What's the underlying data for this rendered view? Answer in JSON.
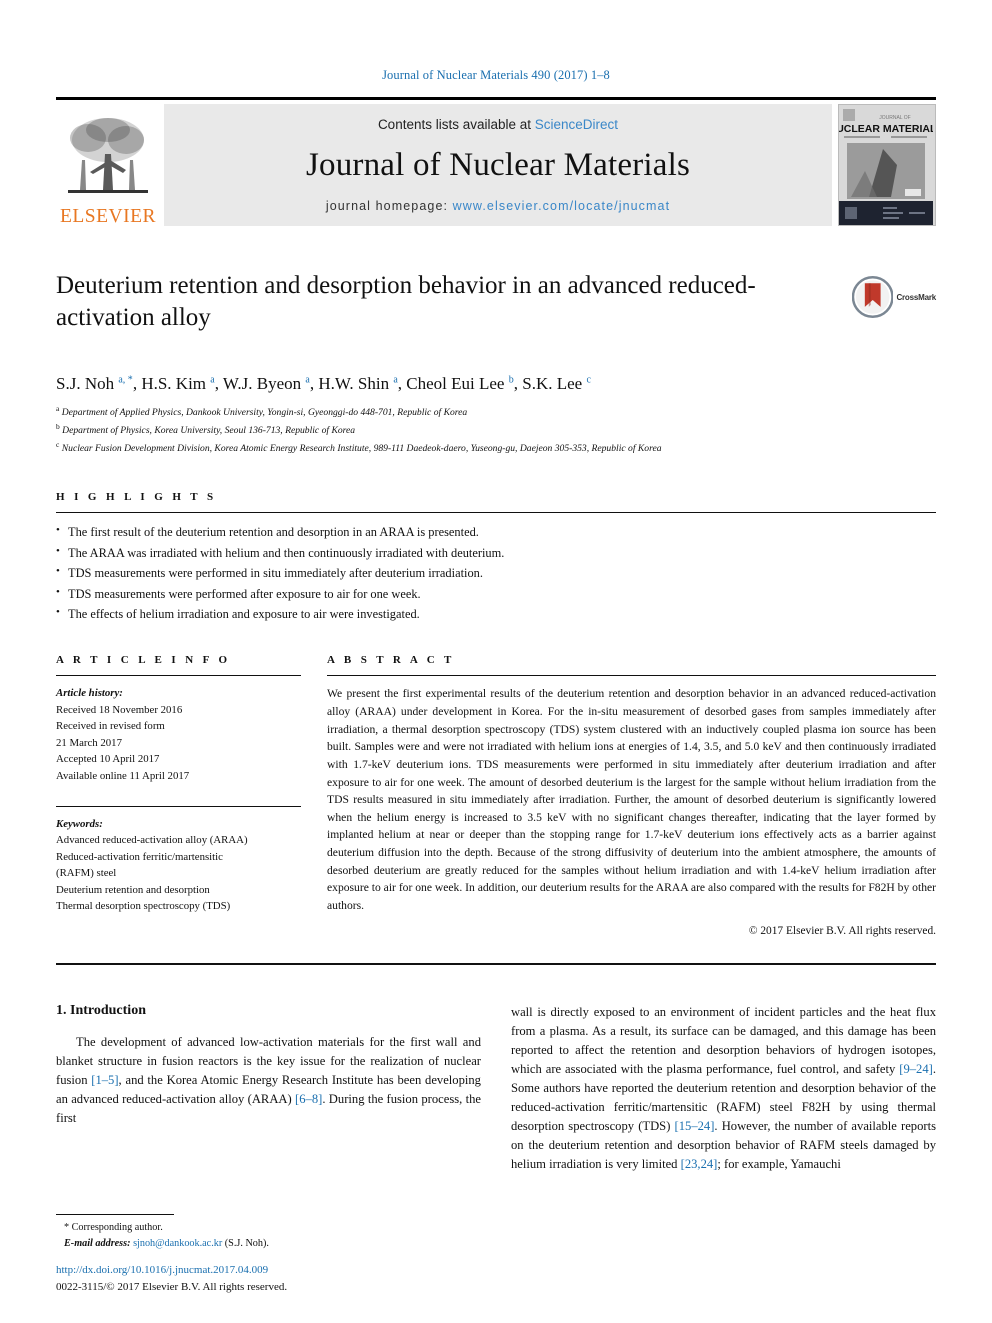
{
  "running_head": "Journal of Nuclear Materials 490 (2017) 1–8",
  "masthead": {
    "publisher": "ELSEVIER",
    "contents_prefix": "Contents lists available at ",
    "contents_link": "ScienceDirect",
    "journal_name": "Journal of Nuclear Materials",
    "homepage_prefix": "journal homepage: ",
    "homepage_url": "www.elsevier.com/locate/jnucmat",
    "cover_title_line1": "JOURNAL OF",
    "cover_title_line2": "NUCLEAR MATERIALS"
  },
  "article": {
    "title": "Deuterium retention and desorption behavior in an advanced reduced-activation alloy",
    "crossmark_label": "CrossMark",
    "authors_html": "S.J. Noh <sup>a, *</sup>, H.S. Kim <sup>a</sup>, W.J. Byeon <sup>a</sup>, H.W. Shin <sup>a</sup>, Cheol Eui Lee <sup>b</sup>, S.K. Lee <sup>c</sup>",
    "affiliations": [
      {
        "marker": "a",
        "text": "Department of Applied Physics, Dankook University, Yongin-si, Gyeonggi-do 448-701, Republic of Korea"
      },
      {
        "marker": "b",
        "text": "Department of Physics, Korea University, Seoul 136-713, Republic of Korea"
      },
      {
        "marker": "c",
        "text": "Nuclear Fusion Development Division, Korea Atomic Energy Research Institute, 989-111 Daedeok-daero, Yuseong-gu, Daejeon 305-353, Republic of Korea"
      }
    ]
  },
  "highlights": {
    "heading": "H I G H L I G H T S",
    "items": [
      "The first result of the deuterium retention and desorption in an ARAA is presented.",
      "The ARAA was irradiated with helium and then continuously irradiated with deuterium.",
      "TDS measurements were performed in situ immediately after deuterium irradiation.",
      "TDS measurements were performed after exposure to air for one week.",
      "The effects of helium irradiation and exposure to air were investigated."
    ]
  },
  "article_info": {
    "heading": "A R T I C L E   I N F O",
    "history_title": "Article history:",
    "history_lines": [
      "Received 18 November 2016",
      "Received in revised form",
      "21 March 2017",
      "Accepted 10 April 2017",
      "Available online 11 April 2017"
    ],
    "keywords_title": "Keywords:",
    "keywords": [
      "Advanced reduced-activation alloy (ARAA)",
      "Reduced-activation ferritic/martensitic",
      "(RAFM) steel",
      "Deuterium retention and desorption",
      "Thermal desorption spectroscopy (TDS)"
    ]
  },
  "abstract": {
    "heading": "A B S T R A C T",
    "text": "We present the first experimental results of the deuterium retention and desorption behavior in an advanced reduced-activation alloy (ARAA) under development in Korea. For the in-situ measurement of desorbed gases from samples immediately after irradiation, a thermal desorption spectroscopy (TDS) system clustered with an inductively coupled plasma ion source has been built. Samples were and were not irradiated with helium ions at energies of 1.4, 3.5, and 5.0 keV and then continuously irradiated with 1.7-keV deuterium ions. TDS measurements were performed in situ immediately after deuterium irradiation and after exposure to air for one week. The amount of desorbed deuterium is the largest for the sample without helium irradiation from the TDS results measured in situ immediately after irradiation. Further, the amount of desorbed deuterium is significantly lowered when the helium energy is increased to 3.5 keV with no significant changes thereafter, indicating that the layer formed by implanted helium at near or deeper than the stopping range for 1.7-keV deuterium ions effectively acts as a barrier against deuterium diffusion into the depth. Because of the strong diffusivity of deuterium into the ambient atmosphere, the amounts of desorbed deuterium are greatly reduced for the samples without helium irradiation and with 1.4-keV helium irradiation after exposure to air for one week. In addition, our deuterium results for the ARAA are also compared with the results for F82H by other authors.",
    "copyright": "© 2017 Elsevier B.V. All rights reserved."
  },
  "body": {
    "section_heading": "1. Introduction",
    "left_paragraph_html": "The development of advanced low-activation materials for the first wall and blanket structure in fusion reactors is the key issue for the realization of nuclear fusion <span class=\"ref\">[1–5]</span>, and the Korea Atomic Energy Research Institute has been developing an advanced reduced-activation alloy (ARAA) <span class=\"ref\">[6–8]</span>. During the fusion process, the first",
    "right_paragraph_html": "wall is directly exposed to an environment of incident particles and the heat flux from a plasma. As a result, its surface can be damaged, and this damage has been reported to affect the retention and desorption behaviors of hydrogen isotopes, which are associated with the plasma performance, fuel control, and safety <span class=\"ref\">[9–24]</span>. Some authors have reported the deuterium retention and desorption behavior of the reduced-activation ferritic/martensitic (RAFM) steel F82H by using thermal desorption spectroscopy (TDS) <span class=\"ref\">[15–24]</span>. However, the number of available reports on the deuterium retention and desorption behavior of RAFM steels damaged by helium irradiation is very limited <span class=\"ref\">[23,24]</span>; for example, Yamauchi"
  },
  "footer": {
    "corresponding_marker": "*",
    "corresponding_label": "Corresponding author.",
    "email_label": "E-mail address:",
    "email": "sjnoh@dankook.ac.kr",
    "email_suffix": "(S.J. Noh).",
    "doi": "http://dx.doi.org/10.1016/j.jnucmat.2017.04.009",
    "issn_line": "0022-3115/© 2017 Elsevier B.V. All rights reserved."
  },
  "colors": {
    "link_blue": "#1a6faf",
    "sciencedirect_blue": "#3a87c8",
    "elsevier_orange": "#E87722",
    "band_gray": "#e9e9e9"
  }
}
